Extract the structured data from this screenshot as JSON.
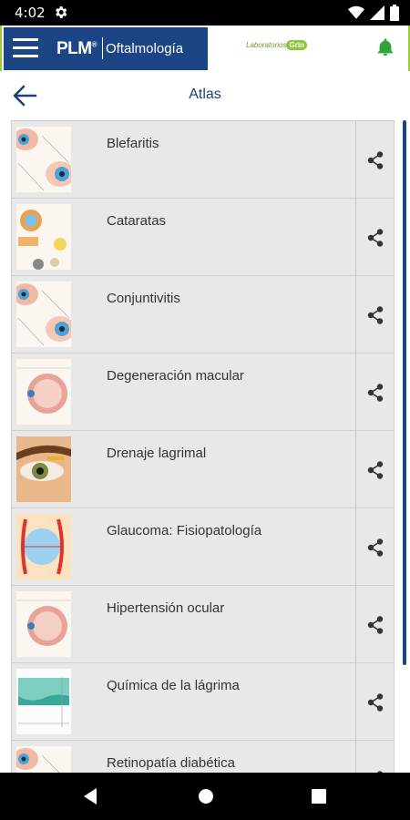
{
  "status_bar": {
    "time": "4:02",
    "icons": [
      "gear-icon",
      "wifi-icon",
      "signal-icon",
      "battery-icon"
    ]
  },
  "app_header": {
    "brand": "PLM",
    "specialty": "Oftalmología",
    "sponsor_prefix": "Laboratorios",
    "sponsor_name": "Grin",
    "accent_color": "#9ccd39",
    "brand_color": "#1c4586"
  },
  "page": {
    "title": "Atlas"
  },
  "atlas_items": [
    {
      "label": "Blefaritis",
      "thumb": "eye-diagram"
    },
    {
      "label": "Cataratas",
      "thumb": "eye-lens-diagram"
    },
    {
      "label": "Conjuntivitis",
      "thumb": "eye-diagram"
    },
    {
      "label": "Degeneración macular",
      "thumb": "eyeball-section"
    },
    {
      "label": "Drenaje lagrimal",
      "thumb": "eye-photo"
    },
    {
      "label": "Glaucoma: Fisiopatología",
      "thumb": "glaucoma-diagram"
    },
    {
      "label": "Hipertensión ocular",
      "thumb": "eyeball-section"
    },
    {
      "label": "Química de la lágrima",
      "thumb": "tear-chart"
    },
    {
      "label": "Retinopatía diabética",
      "thumb": "eye-diagram"
    }
  ],
  "navigation": {
    "buttons": [
      "back-triangle",
      "home-circle",
      "recents-square"
    ]
  }
}
